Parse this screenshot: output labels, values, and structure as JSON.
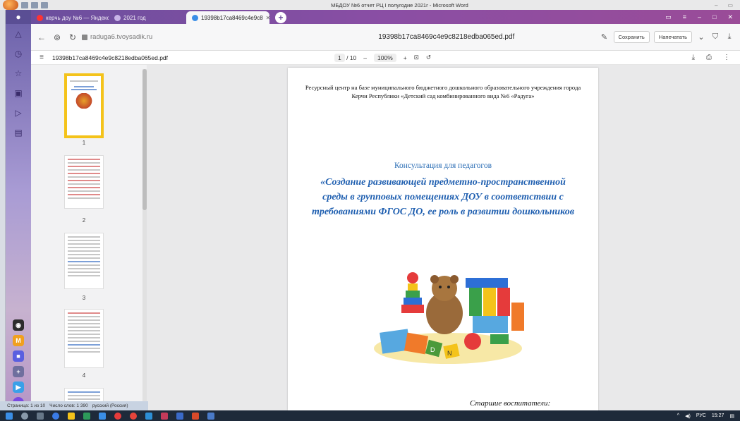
{
  "word": {
    "title": "МБДОУ №6 отчет  РЦ I полугодие 2021г - Microsoft Word",
    "status": [
      "Страница: 1 из 10",
      "Число слов: 1 390",
      "русский (Россия)"
    ]
  },
  "browser": {
    "tabs": [
      {
        "label": "керчь доу №6 — Яндекс",
        "active": false
      },
      {
        "label": "2021 год",
        "active": false
      },
      {
        "label": "19398b17ca8469c4e9c8",
        "active": true
      }
    ],
    "url": "raduga6.tvoysadik.ru",
    "page_title": "19398b17ca8469c4e9c8218edba065ed.pdf",
    "actions": {
      "save": "Сохранить",
      "print": "Напечатать"
    }
  },
  "pdf": {
    "filename": "19398b17ca8469c4e9c8218edba065ed.pdf",
    "page_current": "1",
    "page_total": "/ 10",
    "zoom": "100%",
    "thumbnails": [
      "1",
      "2",
      "3",
      "4"
    ],
    "content": {
      "org": "Ресурсный центр на базе муниципального бюджетного дошкольного образовательного учреждения города Керчи Республики «Детский сад комбинированного вида №6 «Радуга»",
      "consult": "Консультация для педагогов",
      "heading": "«Создание развивающей  предметно-пространственной среды в групповых помещениях ДОУ в соответствии с требованиями ФГОС ДО, ее роль в развитии дошкольников",
      "seniors": "Старшие воспитатели:"
    }
  },
  "taskbar": {
    "lang": "РУС",
    "time": "15:27"
  },
  "colors": {
    "accent": "#1f5fb0",
    "thumb_selected": "#f4c31a"
  }
}
